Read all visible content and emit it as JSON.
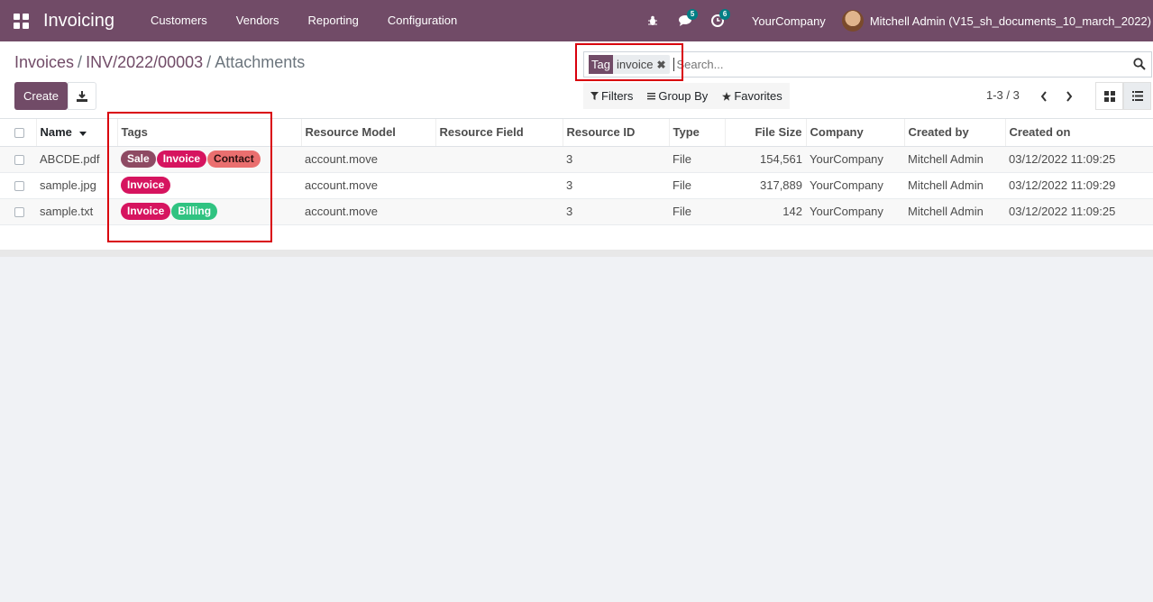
{
  "navbar": {
    "app_name": "Invoicing",
    "menu": [
      "Customers",
      "Vendors",
      "Reporting",
      "Configuration"
    ],
    "messages_badge": "5",
    "activities_badge": "6",
    "company": "YourCompany",
    "user": "Mitchell Admin (V15_sh_documents_10_march_2022)"
  },
  "breadcrumb": {
    "items": [
      "Invoices",
      "INV/2022/00003"
    ],
    "active": "Attachments"
  },
  "buttons": {
    "create": "Create"
  },
  "search": {
    "facet_category": "Tag",
    "facet_value": "invoice",
    "placeholder": "Search..."
  },
  "filters": {
    "filters": "Filters",
    "group_by": "Group By",
    "favorites": "Favorites"
  },
  "pager": {
    "value": "1-3 / 3"
  },
  "table": {
    "columns": [
      "Name",
      "Tags",
      "Resource Model",
      "Resource Field",
      "Resource ID",
      "Type",
      "File Size",
      "Company",
      "Created by",
      "Created on"
    ],
    "rows": [
      {
        "name": "ABCDE.pdf",
        "tags": [
          {
            "label": "Sale",
            "color": "#8e4a63"
          },
          {
            "label": "Invoice",
            "color": "#d6145f"
          },
          {
            "label": "Contact",
            "color": "#ea6f6f",
            "text": "#2b1010"
          }
        ],
        "model": "account.move",
        "field": "",
        "res_id": "3",
        "type": "File",
        "size": "154,561",
        "company": "YourCompany",
        "created_by": "Mitchell Admin",
        "created_on": "03/12/2022 11:09:25"
      },
      {
        "name": "sample.jpg",
        "tags": [
          {
            "label": "Invoice",
            "color": "#d6145f"
          }
        ],
        "model": "account.move",
        "field": "",
        "res_id": "3",
        "type": "File",
        "size": "317,889",
        "company": "YourCompany",
        "created_by": "Mitchell Admin",
        "created_on": "03/12/2022 11:09:29"
      },
      {
        "name": "sample.txt",
        "tags": [
          {
            "label": "Invoice",
            "color": "#d6145f"
          },
          {
            "label": "Billing",
            "color": "#30c381"
          }
        ],
        "model": "account.move",
        "field": "",
        "res_id": "3",
        "type": "File",
        "size": "142",
        "company": "YourCompany",
        "created_by": "Mitchell Admin",
        "created_on": "03/12/2022 11:09:25"
      }
    ]
  },
  "colors": {
    "brand": "#714b67",
    "highlight": "#d9000d"
  }
}
